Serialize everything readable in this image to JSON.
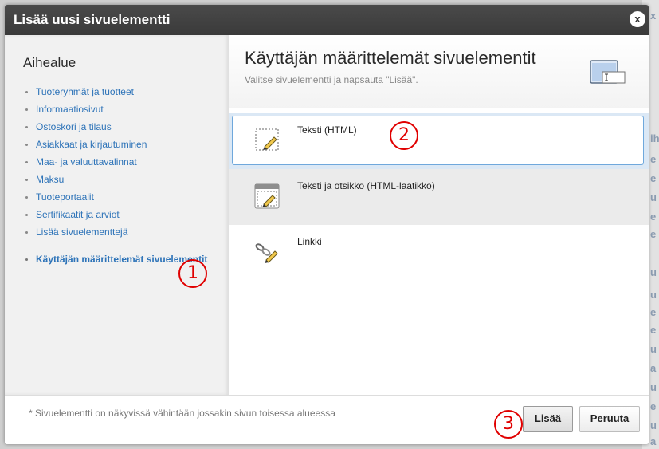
{
  "dialog": {
    "title": "Lisää uusi sivuelementti",
    "close_label": "x"
  },
  "sidebar": {
    "title": "Aihealue",
    "items": [
      {
        "label": "Tuoteryhmät ja tuotteet"
      },
      {
        "label": "Informaatiosivut"
      },
      {
        "label": "Ostoskori ja tilaus"
      },
      {
        "label": "Asiakkaat ja kirjautuminen"
      },
      {
        "label": "Maa- ja valuuttavalinnat"
      },
      {
        "label": "Maksu"
      },
      {
        "label": "Tuoteportaalit"
      },
      {
        "label": "Sertifikaatit ja arviot"
      },
      {
        "label": "Lisää sivuelementtejä"
      }
    ],
    "active_item": {
      "label": "Käyttäjän määrittelemät sivuelementit"
    }
  },
  "main": {
    "title": "Käyttäjän määrittelemät sivuelementit",
    "subtitle": "Valitse sivuelementti ja napsauta \"Lisää\".",
    "header_icon": "window-text-field-icon",
    "elements": [
      {
        "label": "Teksti (HTML)",
        "icon": "pencil-box-icon",
        "selected": true
      },
      {
        "label": "Teksti ja otsikko (HTML-laatikko)",
        "icon": "pencil-window-icon",
        "selected": false
      },
      {
        "label": "Linkki",
        "icon": "chain-pencil-icon",
        "selected": false
      }
    ]
  },
  "footer": {
    "note": "* Sivuelementti on näkyvissä vähintään jossakin sivun toisessa alueessa",
    "add_label": "Lisää",
    "cancel_label": "Peruuta"
  },
  "markers": [
    "1",
    "2",
    "3"
  ],
  "colors": {
    "titlebar": "#3f3f3f",
    "link": "#2d73b8",
    "selected_row": "#dbe8f5",
    "marker": "#e00000"
  },
  "background_chars": [
    "x",
    "ih",
    "e",
    "e",
    "u",
    "e",
    "e",
    "u",
    "u",
    "e",
    "e",
    "u",
    "a",
    "u",
    "e",
    "u",
    "a"
  ]
}
